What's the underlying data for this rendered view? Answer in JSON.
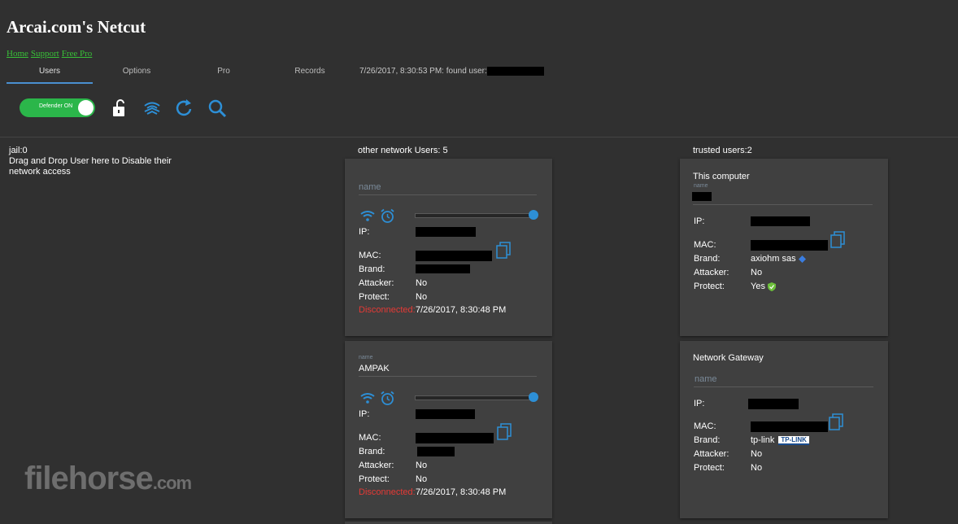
{
  "app": {
    "title": "Arcai.com's Netcut"
  },
  "links": [
    "Home",
    "Support",
    "Free Pro"
  ],
  "tabs": [
    {
      "label": "Users",
      "active": true
    },
    {
      "label": "Options",
      "active": false
    },
    {
      "label": "Pro",
      "active": false
    },
    {
      "label": "Records",
      "active": false
    }
  ],
  "status": {
    "found_text": "7/26/2017, 8:30:53 PM: found user:"
  },
  "toolbar": {
    "defender_label": "Defender ON",
    "defender_on": true,
    "icons": [
      "unlock-icon",
      "network-icon",
      "refresh-icon",
      "search-icon"
    ]
  },
  "jail": {
    "title": "jail:0",
    "hint": "Drag and Drop User here to Disable their network access"
  },
  "other": {
    "header": "other network Users: 5",
    "cards": [
      {
        "name_label": "name",
        "name_placeholder": "name",
        "name_value": "",
        "ip_label": "IP:",
        "mac_label": "MAC:",
        "brand_label": "Brand:",
        "attacker_label": "Attacker:",
        "attacker": "No",
        "protect_label": "Protect:",
        "protect": "No",
        "disconnected_label": "Disconnected:",
        "disconnected_time": "7/26/2017, 8:30:48 PM"
      },
      {
        "name_label": "name",
        "name_placeholder": "",
        "name_value": "AMPAK",
        "ip_label": "IP:",
        "mac_label": "MAC:",
        "brand_label": "Brand:",
        "attacker_label": "Attacker:",
        "attacker": "No",
        "protect_label": "Protect:",
        "protect": "No",
        "disconnected_label": "Disconnected:",
        "disconnected_time": "7/26/2017, 8:30:48 PM"
      }
    ]
  },
  "trusted": {
    "header": "trusted users:2",
    "cards": [
      {
        "title": "This computer",
        "name_label": "name",
        "ip_label": "IP:",
        "mac_label": "MAC:",
        "brand_label": "Brand:",
        "brand": "axiohm sas",
        "attacker_label": "Attacker:",
        "attacker": "No",
        "protect_label": "Protect:",
        "protect": "Yes"
      },
      {
        "title": "Network Gateway",
        "name_placeholder": "name",
        "ip_label": "IP:",
        "mac_label": "MAC:",
        "brand_label": "Brand:",
        "brand": "tp-link",
        "brand_logo": "TP-LINK",
        "attacker_label": "Attacker:",
        "attacker": "No",
        "protect_label": "Protect:",
        "protect": "No"
      }
    ]
  },
  "watermark": {
    "main": "filehorse",
    "suffix": ".com"
  },
  "colors": {
    "background": "#303030",
    "card": "#404040",
    "accent": "#2d8fd6",
    "toggle": "#2bb64a",
    "link": "#38c038",
    "danger": "#e53935"
  }
}
